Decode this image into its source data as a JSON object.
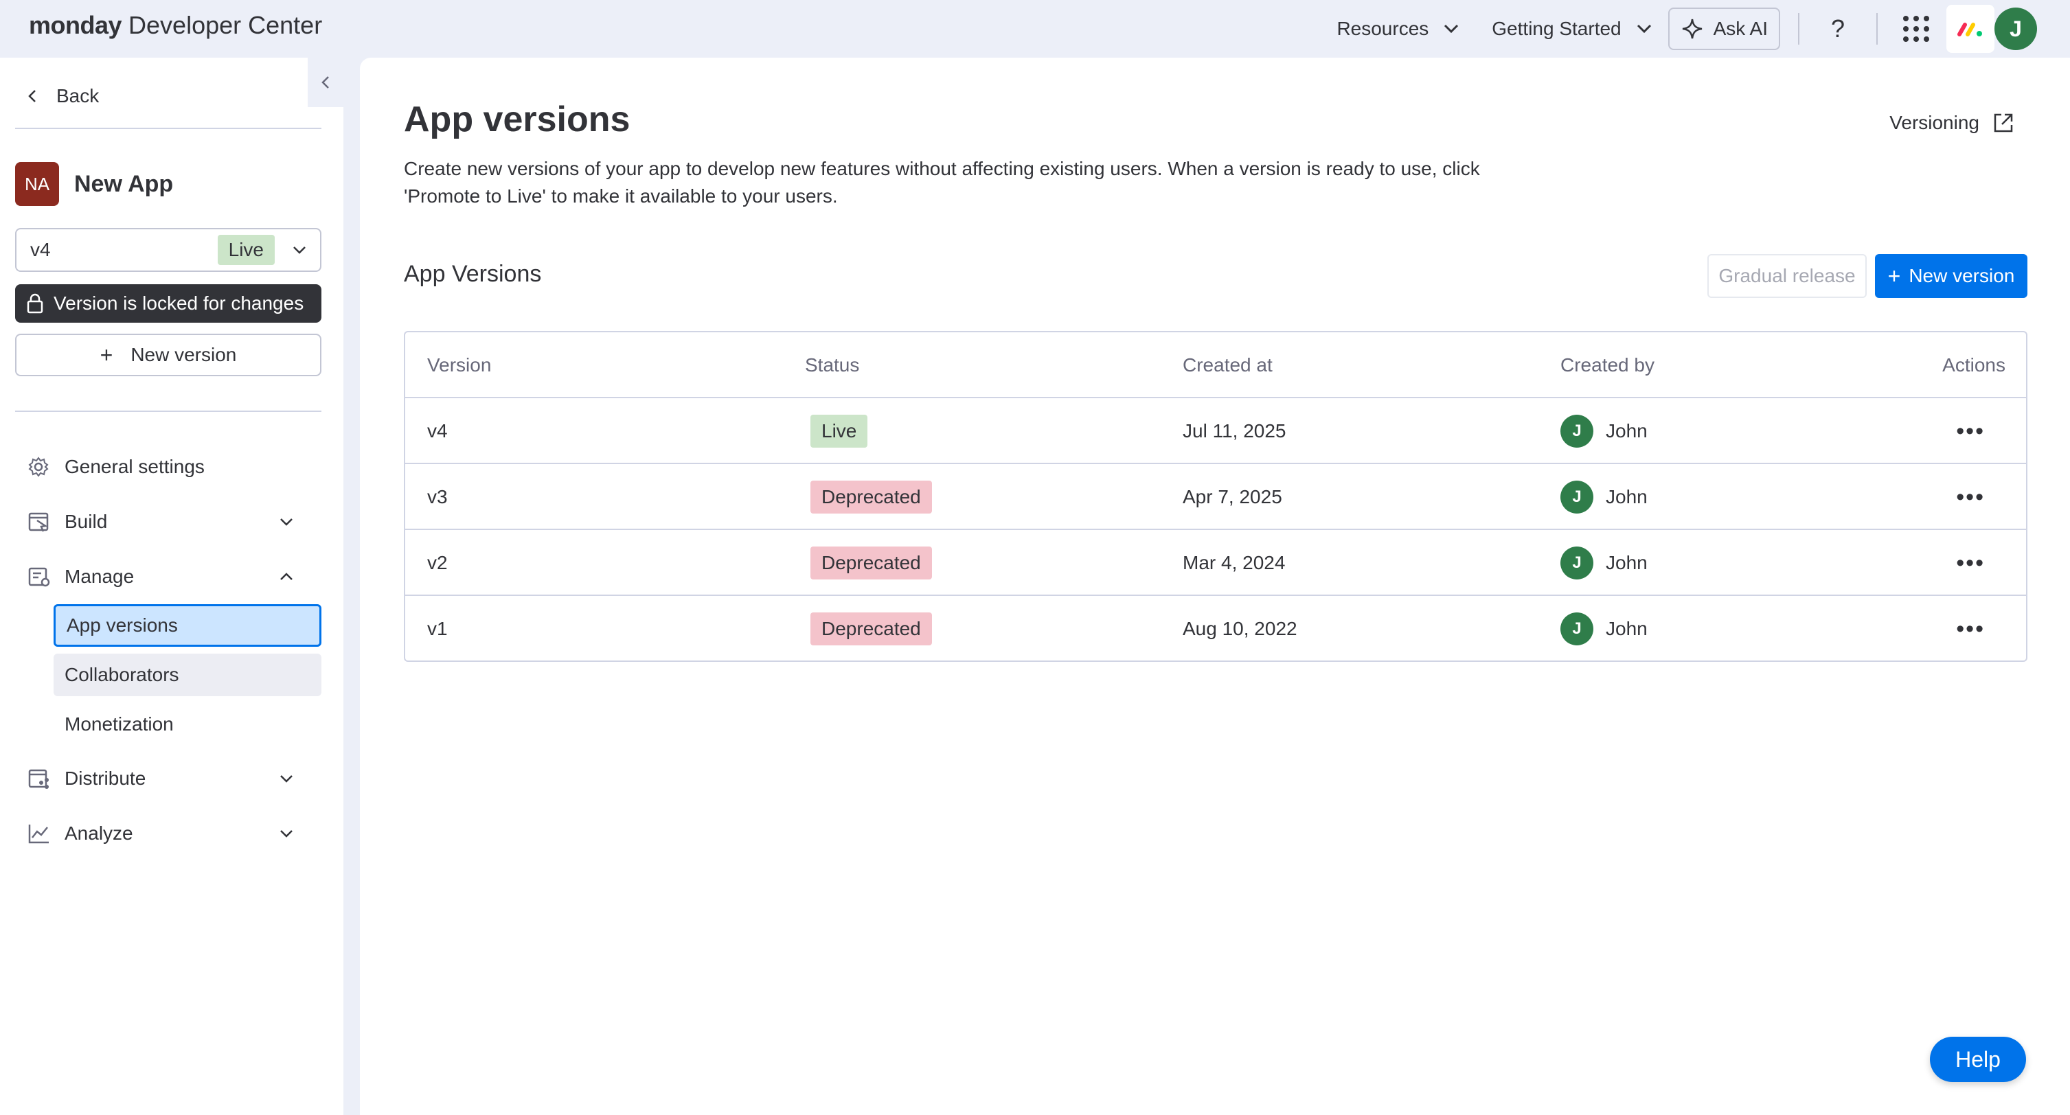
{
  "header": {
    "brand_bold": "monday",
    "brand_rest": " Developer Center",
    "nav": [
      {
        "label": "Resources"
      },
      {
        "label": "Getting Started"
      }
    ],
    "ask_ai": "Ask AI",
    "help_glyph": "?",
    "user_initial": "J"
  },
  "sidebar": {
    "back": "Back",
    "app_initials": "NA",
    "app_name": "New App",
    "version_select": {
      "value": "v4",
      "badge": "Live"
    },
    "locked_text": "Version is locked for changes",
    "new_version": "New version",
    "menu": [
      {
        "label": "General settings",
        "icon": "gear-icon"
      },
      {
        "label": "Build",
        "icon": "build-icon",
        "expanded": false
      },
      {
        "label": "Manage",
        "icon": "manage-icon",
        "expanded": true
      },
      {
        "label": "Distribute",
        "icon": "distribute-icon",
        "expanded": false
      },
      {
        "label": "Analyze",
        "icon": "chart-line-icon",
        "expanded": false
      }
    ],
    "manage_sub": [
      {
        "label": "App versions",
        "active": true
      },
      {
        "label": "Collaborators"
      },
      {
        "label": "Monetization"
      }
    ]
  },
  "main": {
    "title": "App versions",
    "description": "Create new versions of your app to develop new features without affecting existing users. When a version is ready to use, click 'Promote to Live' to make it available to your users.",
    "versioning_link": "Versioning",
    "section_title": "App Versions",
    "gradual_release": "Gradual release",
    "new_version": "New version",
    "table": {
      "columns": [
        "Version",
        "Status",
        "Created at",
        "Created by",
        "Actions"
      ],
      "rows": [
        {
          "version": "v4",
          "status": "Live",
          "created_at": "Jul 11, 2025",
          "created_by": "John",
          "initial": "J"
        },
        {
          "version": "v3",
          "status": "Deprecated",
          "created_at": "Apr 7, 2025",
          "created_by": "John",
          "initial": "J"
        },
        {
          "version": "v2",
          "status": "Deprecated",
          "created_at": "Mar 4, 2024",
          "created_by": "John",
          "initial": "J"
        },
        {
          "version": "v1",
          "status": "Deprecated",
          "created_at": "Aug 10, 2022",
          "created_by": "John",
          "initial": "J"
        }
      ]
    }
  },
  "help_button": "Help",
  "colors": {
    "primary": "#0073ea",
    "live": "#cce5c9",
    "deprecated": "#f4c3cb",
    "avatar": "#2f7d4a",
    "app_avatar": "#8b2a1f"
  }
}
